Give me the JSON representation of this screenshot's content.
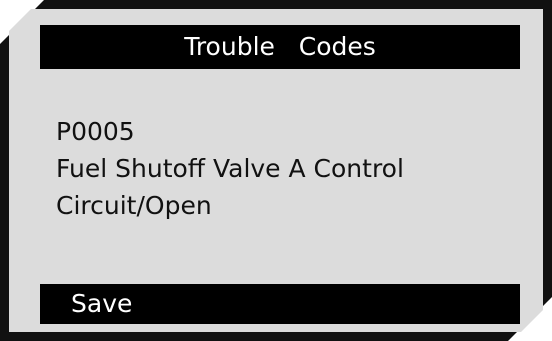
{
  "screen": {
    "title": "Trouble   Codes"
  },
  "dtc": {
    "code": "P0005",
    "description_line1": "Fuel Shutoff Valve A Control",
    "description_line2": "Circuit/Open"
  },
  "actions": {
    "save_label": "Save"
  },
  "colors": {
    "screen_background": "#dcdcdc",
    "bar_background": "#000000",
    "bar_text": "#ffffff",
    "body_text": "#111111",
    "bezel": "#111111"
  }
}
